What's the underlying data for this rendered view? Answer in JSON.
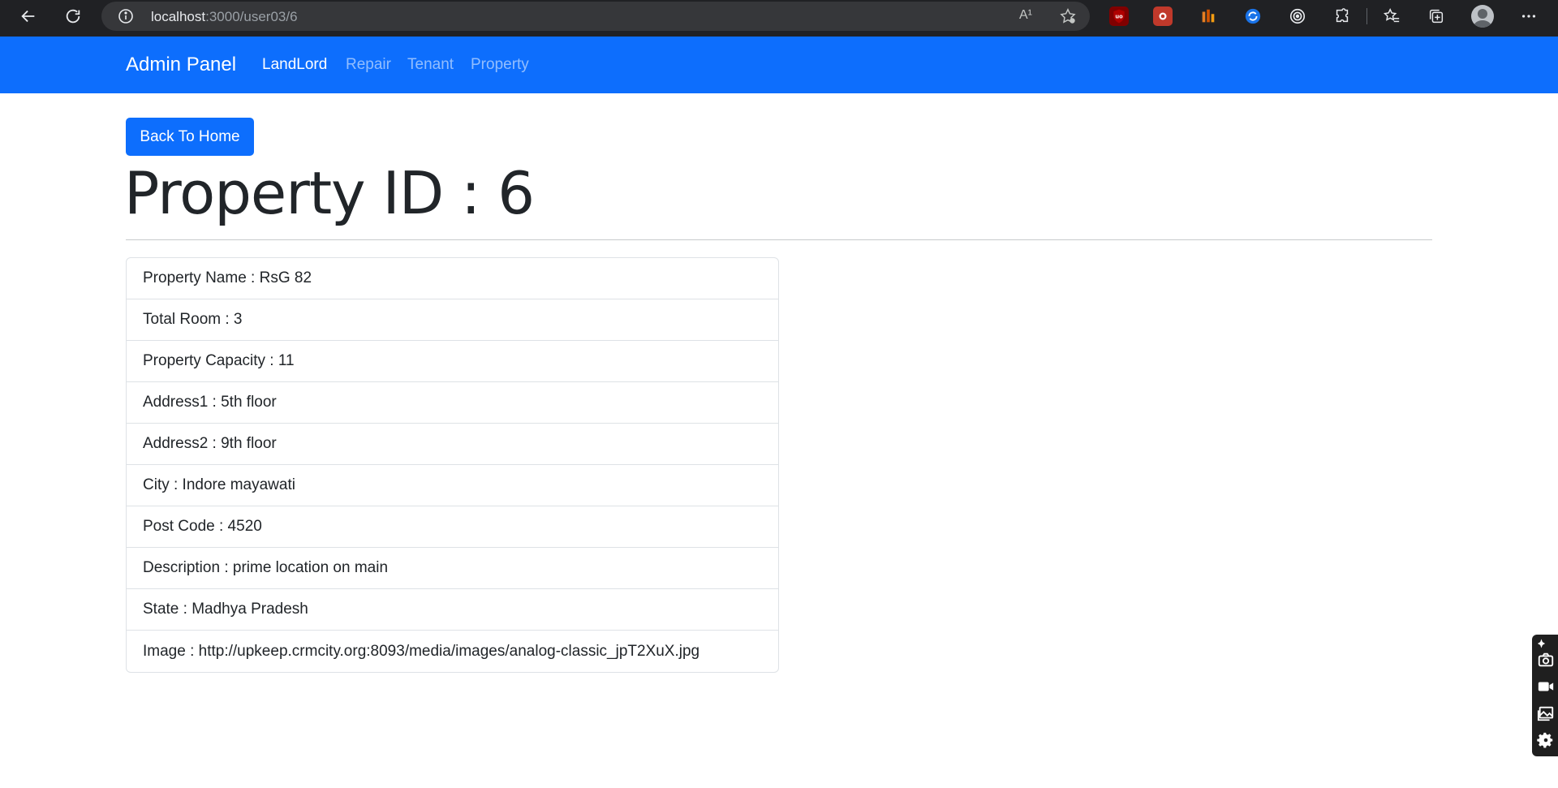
{
  "browser": {
    "url_host": "localhost",
    "url_path": ":3000/user03/6",
    "read_aloud_label": "A¹"
  },
  "navbar": {
    "brand": "Admin Panel",
    "links": [
      {
        "label": "LandLord",
        "active": true
      },
      {
        "label": "Repair",
        "active": false
      },
      {
        "label": "Tenant",
        "active": false
      },
      {
        "label": "Property",
        "active": false
      }
    ]
  },
  "main": {
    "back_button": "Back To Home",
    "title": "Property ID : 6",
    "details": [
      "Property Name : RsG 82",
      "Total Room : 3",
      "Property Capacity : 11",
      "Address1 : 5th floor",
      "Address2 : 9th floor",
      "City : Indore mayawati",
      "Post Code : 4520",
      "Description : prime location on main",
      "State : Madhya Pradesh",
      "Image : http://upkeep.crmcity.org:8093/media/images/analog-classic_jpT2XuX.jpg"
    ]
  },
  "colors": {
    "primary": "#0d6efd",
    "chrome_bg": "#202124",
    "text": "#212529"
  }
}
